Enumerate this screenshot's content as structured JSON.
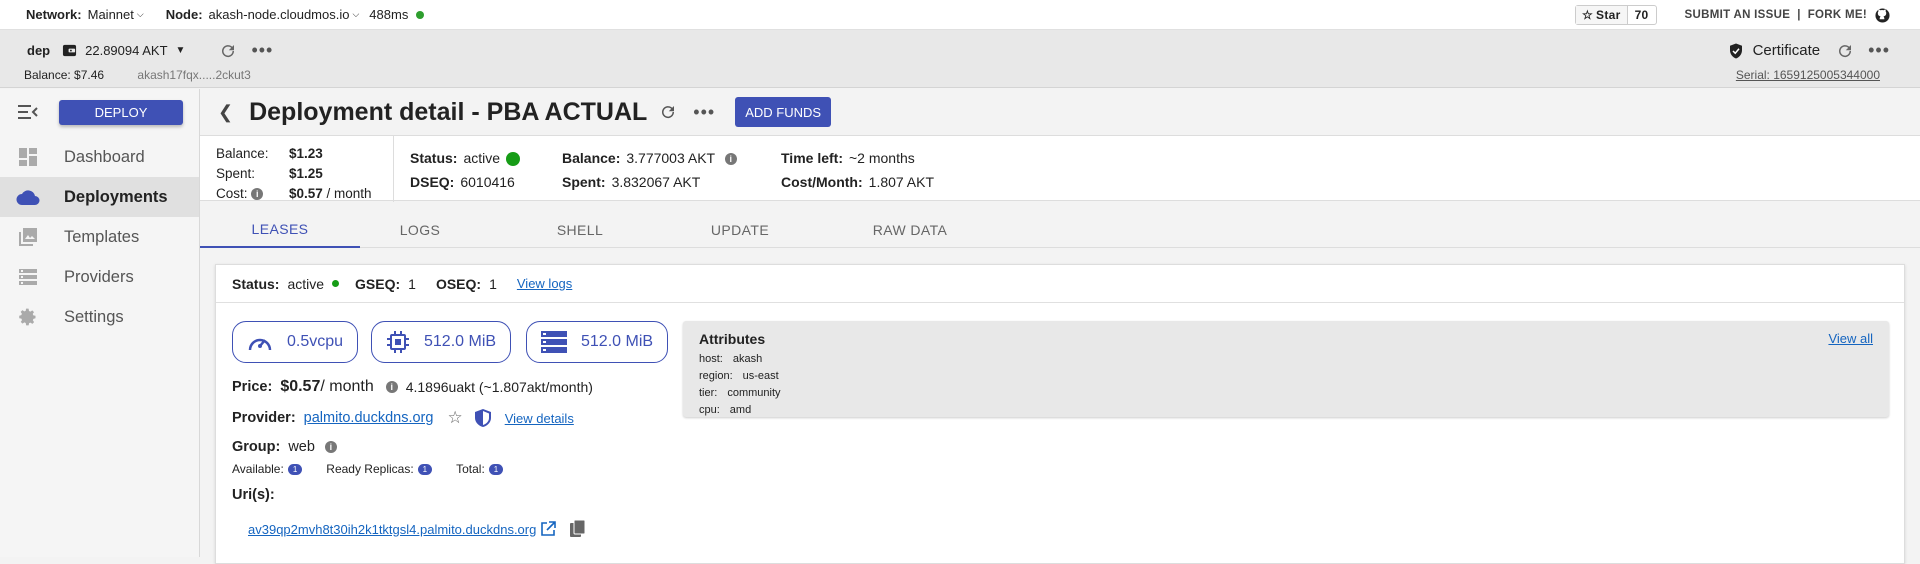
{
  "topbar": {
    "network_label": "Network:",
    "network_value": "Mainnet",
    "node_label": "Node:",
    "node_value": "akash-node.cloudmos.io",
    "latency": "488ms",
    "star_label": "Star",
    "star_count": "70",
    "submit_issue": "SUBMIT AN ISSUE",
    "separator": "|",
    "fork_me": "FORK ME!"
  },
  "wallet": {
    "name": "dep",
    "amount": "22.89094 AKT",
    "balance": "Balance: $7.46",
    "address": "akash17fqx.....2ckut3",
    "certificate": "Certificate",
    "serial": "Serial: 1659125005344000"
  },
  "sidebar": {
    "deploy_label": "DEPLOY",
    "items": [
      {
        "label": "Dashboard"
      },
      {
        "label": "Deployments"
      },
      {
        "label": "Templates"
      },
      {
        "label": "Providers"
      },
      {
        "label": "Settings"
      }
    ]
  },
  "header": {
    "title_bold": "Deployment detail",
    "title_rest": " - PBA ACTUAL",
    "add_funds": "ADD FUNDS"
  },
  "summary": {
    "balance_label": "Balance:",
    "balance_value": "$1.23",
    "spent_label": "Spent:",
    "spent_value": "$1.25",
    "cost_label": "Cost:",
    "cost_value": "$0.57",
    "cost_unit": " / month",
    "status_label": "Status:",
    "status_value": "active",
    "dseq_label": "DSEQ:",
    "dseq_value": "6010416",
    "akt_balance_label": "Balance:",
    "akt_balance_value": "3.777003 AKT",
    "akt_spent_label": "Spent:",
    "akt_spent_value": "3.832067 AKT",
    "time_left_label": "Time left:",
    "time_left_value": "~2 months",
    "cost_month_label": "Cost/Month:",
    "cost_month_value": "1.807 AKT"
  },
  "tabs": [
    "LEASES",
    "LOGS",
    "SHELL",
    "UPDATE",
    "RAW DATA"
  ],
  "lease": {
    "status_label": "Status:",
    "status_value": "active",
    "gseq_label": "GSEQ:",
    "gseq_value": "1",
    "oseq_label": "OSEQ:",
    "oseq_value": "1",
    "view_logs": "View logs",
    "cpu": "0.5vcpu",
    "memory": "512.0 MiB",
    "storage": "512.0 MiB",
    "price_label": "Price:",
    "price_value": "$0.57",
    "price_unit": " / month",
    "price_uakt": "4.1896uakt (~1.807akt/month)",
    "provider_label": "Provider:",
    "provider_value": "palmito.duckdns.org",
    "view_details": "View details",
    "group_label": "Group:",
    "group_value": "web",
    "available_label": "Available:",
    "available_value": "1",
    "ready_label": "Ready Replicas:",
    "ready_value": "1",
    "total_label": "Total:",
    "total_value": "1",
    "uris_label": "Uri(s):",
    "uri": "av39qp2mvh8t30ih2k1tktgsl4.palmito.duckdns.org"
  },
  "attributes": {
    "heading": "Attributes",
    "view_all": "View all",
    "items": [
      {
        "key": "host:",
        "value": "akash"
      },
      {
        "key": "region:",
        "value": "us-east"
      },
      {
        "key": "tier:",
        "value": "community"
      },
      {
        "key": "cpu:",
        "value": "amd"
      }
    ]
  },
  "colors": {
    "accent": "#3f51b5",
    "status_green": "#169c16"
  }
}
